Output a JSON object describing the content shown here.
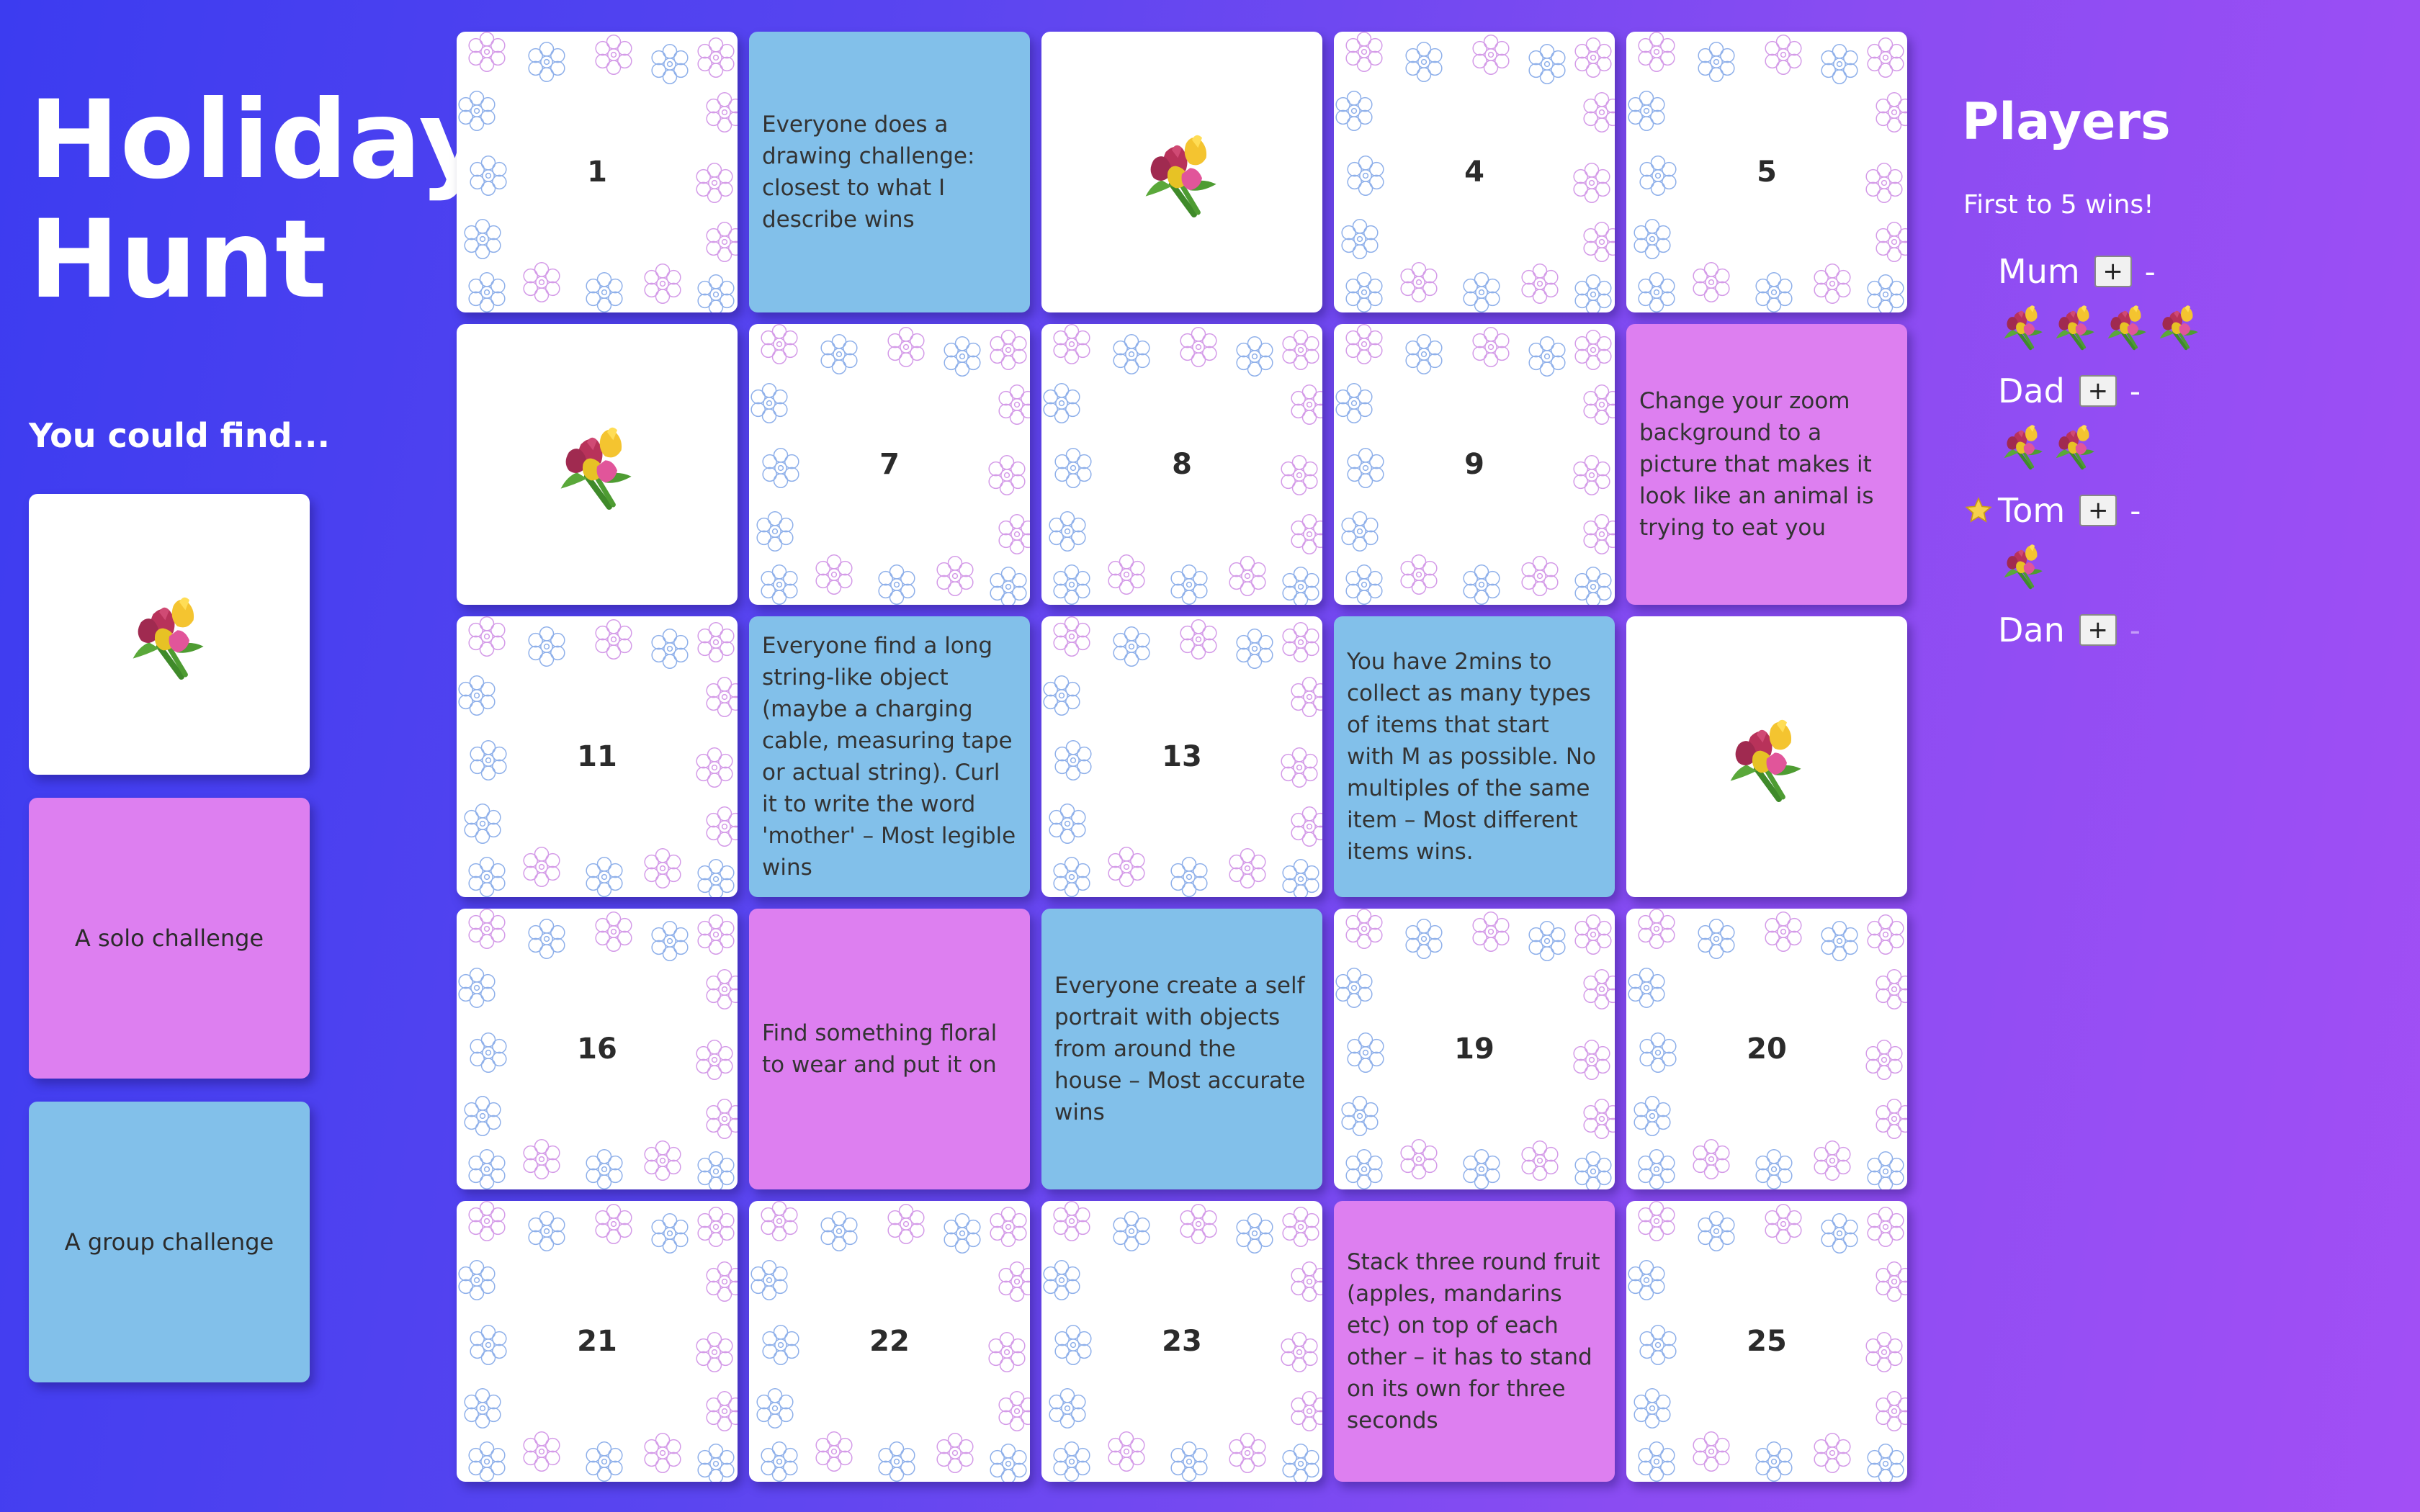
{
  "title": "Holiday Hunt",
  "find_heading": "You could find...",
  "legend": {
    "prize_icon": "bouquet-icon",
    "solo_label": "A solo challenge",
    "group_label": "A group challenge"
  },
  "colors": {
    "solo": "#dd7ff0",
    "group": "#82c0ea",
    "tile": "#ffffff"
  },
  "board": [
    {
      "kind": "hidden",
      "label": "1"
    },
    {
      "kind": "group",
      "label": "Everyone does a drawing challenge: closest to what I describe wins"
    },
    {
      "kind": "prize",
      "label": "bouquet-icon"
    },
    {
      "kind": "hidden",
      "label": "4"
    },
    {
      "kind": "hidden",
      "label": "5"
    },
    {
      "kind": "prize",
      "label": "bouquet-icon"
    },
    {
      "kind": "hidden",
      "label": "7"
    },
    {
      "kind": "hidden",
      "label": "8"
    },
    {
      "kind": "hidden",
      "label": "9"
    },
    {
      "kind": "solo",
      "label": "Change your zoom background to a picture that makes it look like an animal is trying to eat you"
    },
    {
      "kind": "hidden",
      "label": "11"
    },
    {
      "kind": "group",
      "label": "Everyone find a long string-like object (maybe a charging cable, measuring tape or actual string). Curl it to write the word 'mother' – Most legible wins"
    },
    {
      "kind": "hidden",
      "label": "13"
    },
    {
      "kind": "group",
      "label": "You have 2mins to collect as many types of items that start with M as possible. No multiples of the same item – Most different items wins."
    },
    {
      "kind": "prize",
      "label": "bouquet-icon"
    },
    {
      "kind": "hidden",
      "label": "16"
    },
    {
      "kind": "solo",
      "label": "Find something floral to wear and put it on"
    },
    {
      "kind": "group",
      "label": "Everyone create a self portrait with objects from around the house – Most accurate wins"
    },
    {
      "kind": "hidden",
      "label": "19"
    },
    {
      "kind": "hidden",
      "label": "20"
    },
    {
      "kind": "hidden",
      "label": "21"
    },
    {
      "kind": "hidden",
      "label": "22"
    },
    {
      "kind": "hidden",
      "label": "23"
    },
    {
      "kind": "solo",
      "label": "Stack three round fruit (apples, mandarins etc) on top of each other – it has to stand on its own for three seconds"
    },
    {
      "kind": "hidden",
      "label": "25"
    }
  ],
  "players": {
    "title": "Players",
    "subtitle": "First to 5 wins!",
    "plus_label": "+",
    "minus_label": "-",
    "list": [
      {
        "name": "Mum",
        "score": 4,
        "starred": false
      },
      {
        "name": "Dad",
        "score": 2,
        "starred": false
      },
      {
        "name": "Tom",
        "score": 1,
        "starred": true
      },
      {
        "name": "Dan",
        "score": 0,
        "starred": false
      }
    ]
  }
}
